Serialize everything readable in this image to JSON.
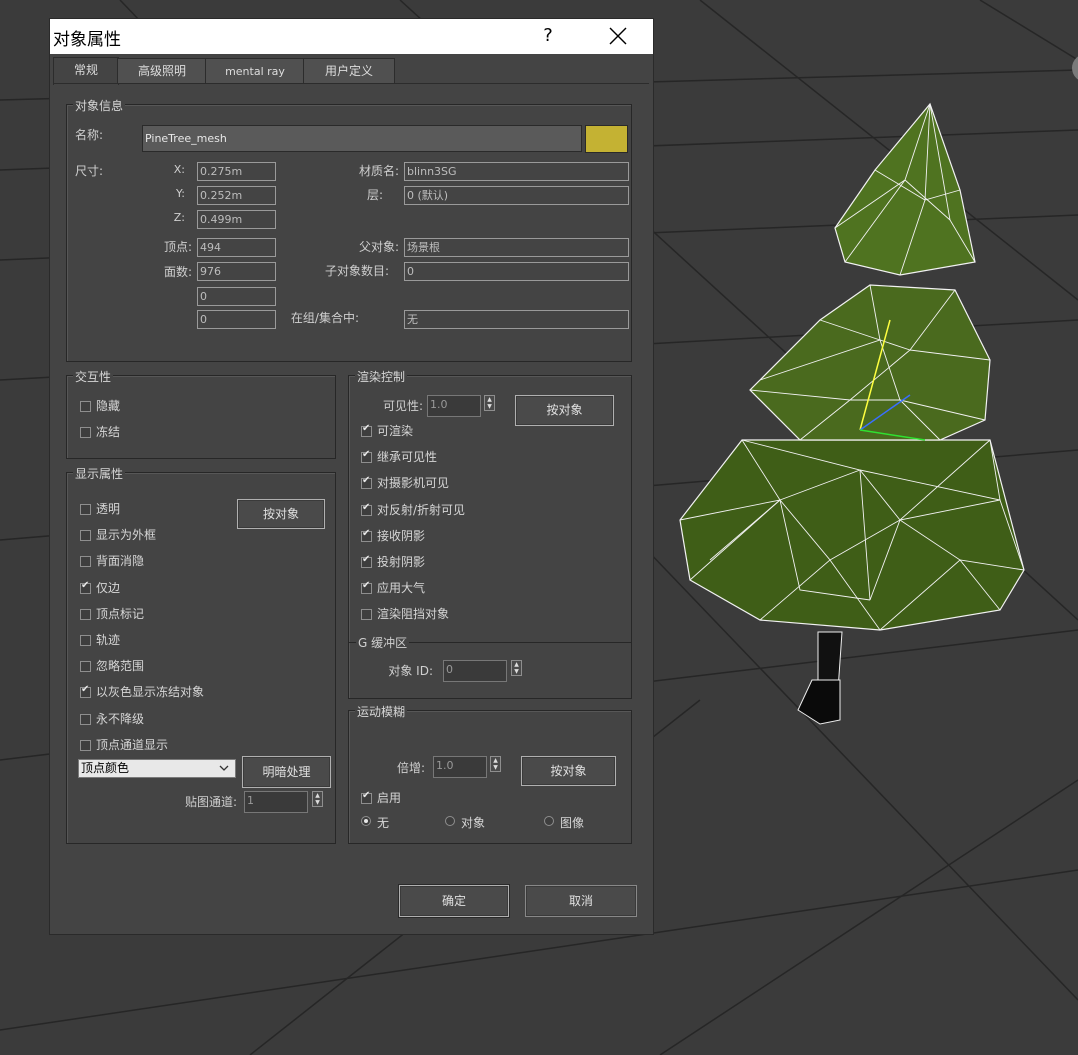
{
  "dialog": {
    "title": "对象属性",
    "help_label": "?",
    "tabs": [
      {
        "label": "常规",
        "active": true
      },
      {
        "label": "高级照明",
        "active": false
      },
      {
        "label": "mental ray",
        "active": false
      },
      {
        "label": "用户定义",
        "active": false
      }
    ],
    "object_info": {
      "legend": "对象信息",
      "name_label": "名称:",
      "name_value": "PineTree_mesh",
      "color": "#c4b233",
      "dims_label": "尺寸:",
      "x_label": "X:",
      "x_value": "0.275m",
      "y_label": "Y:",
      "y_value": "0.252m",
      "z_label": "Z:",
      "z_value": "0.499m",
      "verts_label": "顶点:",
      "verts_value": "494",
      "faces_label": "面数:",
      "faces_value": "976",
      "extra1_value": "0",
      "extra2_value": "0",
      "material_label": "材质名:",
      "material_value": "blinn3SG",
      "layer_label": "层:",
      "layer_value": "0 (默认)",
      "parent_label": "父对象:",
      "parent_value": "场景根",
      "children_label": "子对象数目:",
      "children_value": "0",
      "group_label": "在组/集合中:",
      "group_value": "无"
    },
    "interactivity": {
      "legend": "交互性",
      "hide": {
        "label": "隐藏",
        "checked": false
      },
      "freeze": {
        "label": "冻结",
        "checked": false
      }
    },
    "display": {
      "legend": "显示属性",
      "by_object_label": "按对象",
      "items": [
        {
          "label": "透明",
          "checked": false
        },
        {
          "label": "显示为外框",
          "checked": false
        },
        {
          "label": "背面消隐",
          "checked": false
        },
        {
          "label": "仅边",
          "checked": true
        },
        {
          "label": "顶点标记",
          "checked": false
        },
        {
          "label": "轨迹",
          "checked": false
        },
        {
          "label": "忽略范围",
          "checked": false
        },
        {
          "label": "以灰色显示冻结对象",
          "checked": true
        },
        {
          "label": "永不降级",
          "checked": false
        },
        {
          "label": "顶点通道显示",
          "checked": false
        }
      ],
      "channel_select": "顶点颜色",
      "shading_button": "明暗处理",
      "map_channel_label": "贴图通道:",
      "map_channel_value": "1"
    },
    "render": {
      "legend": "渲染控制",
      "visibility_label": "可见性:",
      "visibility_value": "1.0",
      "by_object_label": "按对象",
      "items": [
        {
          "label": "可渲染",
          "checked": true
        },
        {
          "label": "继承可见性",
          "checked": true
        },
        {
          "label": "对摄影机可见",
          "checked": true
        },
        {
          "label": "对反射/折射可见",
          "checked": true
        },
        {
          "label": "接收阴影",
          "checked": true
        },
        {
          "label": "投射阴影",
          "checked": true
        },
        {
          "label": "应用大气",
          "checked": true
        },
        {
          "label": "渲染阻挡对象",
          "checked": false
        }
      ],
      "gbuffer_legend": "G 缓冲区",
      "object_id_label": "对象 ID:",
      "object_id_value": "0"
    },
    "motion_blur": {
      "legend": "运动模糊",
      "multiplier_label": "倍增:",
      "multiplier_value": "1.0",
      "by_object_label": "按对象",
      "enabled": {
        "label": "启用",
        "checked": true
      },
      "radios": [
        {
          "label": "无",
          "checked": true
        },
        {
          "label": "对象",
          "checked": false
        },
        {
          "label": "图像",
          "checked": false
        }
      ]
    },
    "ok_label": "确定",
    "cancel_label": "取消"
  },
  "colors": {
    "dialog_bg": "#444444",
    "viewport_bg": "#3b3b3b",
    "object_color": "#c4b233",
    "tree_green": "#4a6a1e"
  }
}
